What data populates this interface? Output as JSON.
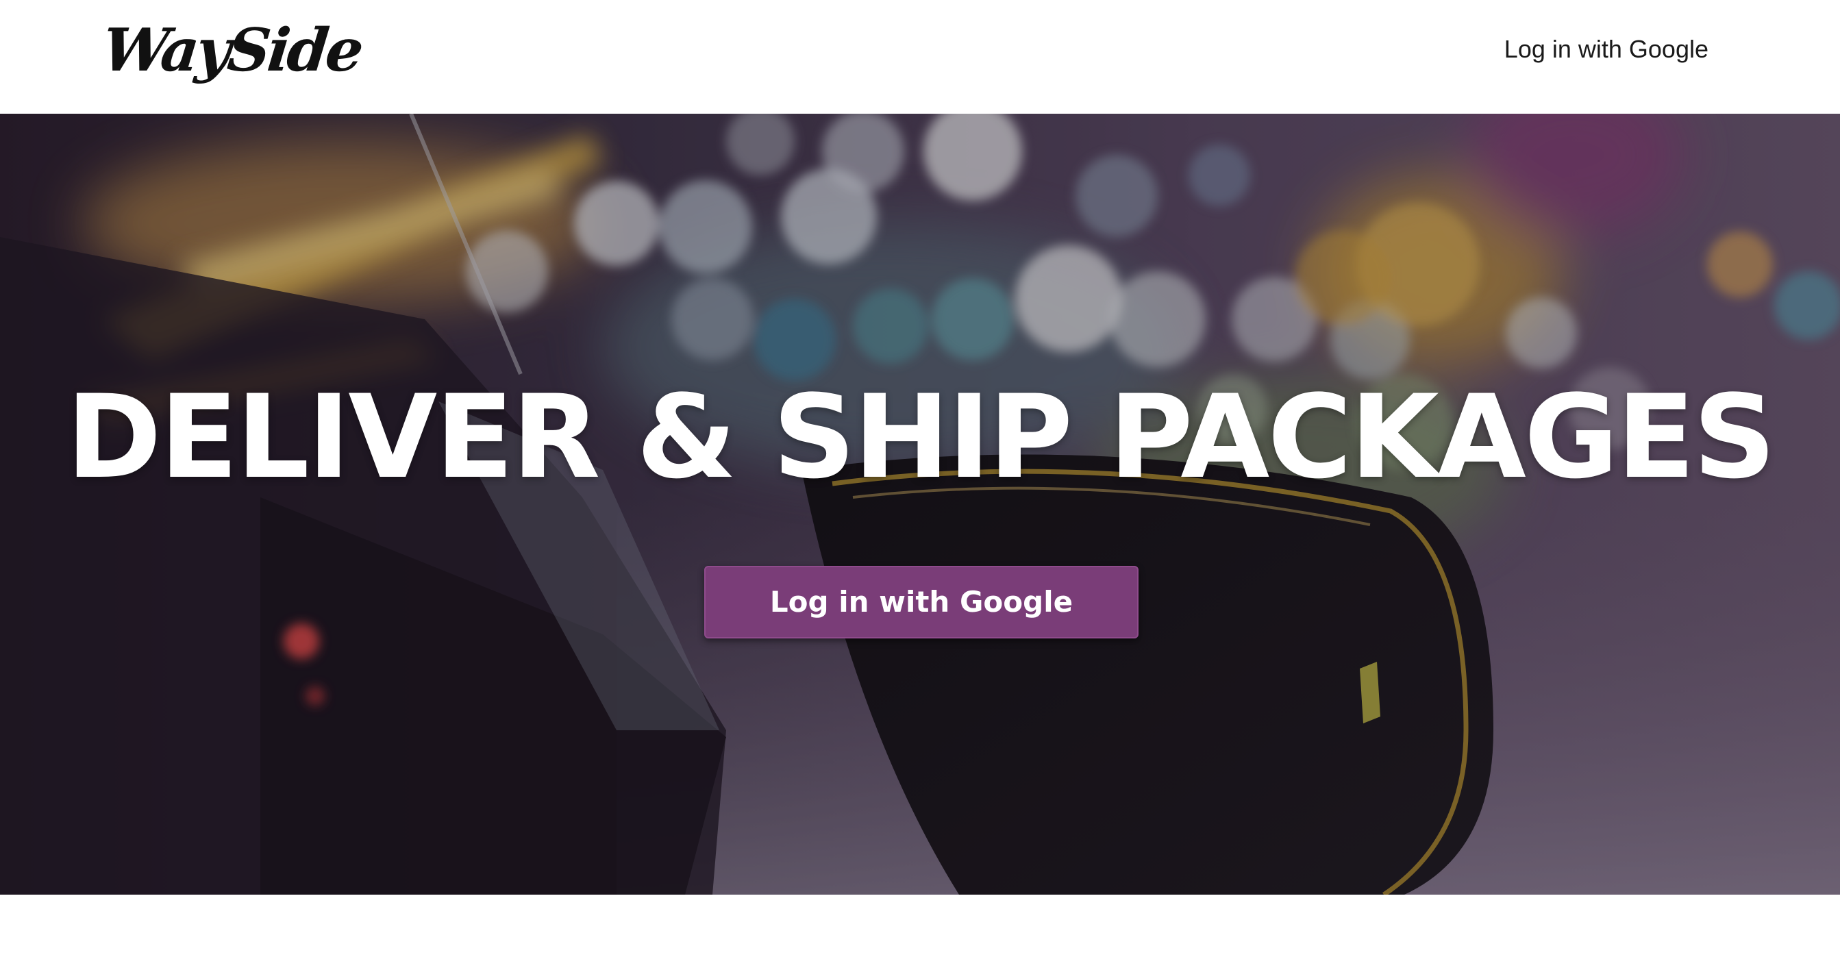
{
  "header": {
    "logo_text": "WaySide",
    "login_link": "Log in with Google"
  },
  "hero": {
    "title": "DELIVER & SHIP PACKAGES",
    "cta_label": "Log in with Google",
    "background_image": "blurred-night-city-lights-car-side-mirror"
  },
  "colors": {
    "header_background": "#ffffff",
    "cta_background": "#7a3d78",
    "hero_text": "#ffffff",
    "nav_text": "#1a1a1a"
  }
}
